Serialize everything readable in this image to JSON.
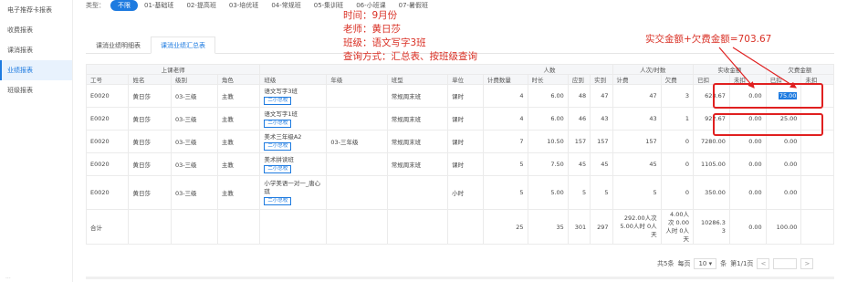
{
  "sidebar": {
    "items": [
      {
        "label": "电子推荐卡报表"
      },
      {
        "label": "收费报表"
      },
      {
        "label": "课消报表"
      },
      {
        "label": "业绩报表"
      },
      {
        "label": "班级报表"
      }
    ],
    "footer": "..."
  },
  "filters": {
    "label": "类型：",
    "chips": [
      "不限",
      "01-基础班",
      "02-提高班",
      "03-培优班",
      "04-常规班",
      "05-集训班",
      "06-小班课",
      "07-暑假班"
    ]
  },
  "tabs": [
    "课消业绩明细表",
    "课消业绩汇总表"
  ],
  "annotation_left": [
    "时间：9月份",
    "老师：黄日莎",
    "班级：语文写字3班",
    "查询方式：汇总表、按班级查询"
  ],
  "annotation_right": "实交金额+欠费金额=703.67",
  "table": {
    "group_headers": {
      "teacher": "上课老师",
      "persons": "人数",
      "person_times": "人次/时数",
      "receive": "实收金额",
      "owe": "欠费金额"
    },
    "columns": [
      "工号",
      "姓名",
      "级别",
      "角色",
      "班级",
      "年级",
      "班型",
      "单位",
      "计费数量",
      "时长",
      "应到",
      "实到",
      "计费",
      "欠费",
      "已扣",
      "未扣",
      "已扣",
      "未扣"
    ],
    "rows": [
      {
        "id": "E0020",
        "name": "黄日莎",
        "level": "03-三级",
        "role": "主教",
        "cls": "语文写字3班",
        "tag": "二小总校",
        "grade": "",
        "type": "常规周末班",
        "unit": "课时",
        "qty": "4",
        "dur": "6.00",
        "due": "48",
        "att": "47",
        "charge": "47",
        "owe": "3",
        "r1": "628.67",
        "r2": "0.00",
        "o1": "75.00",
        "o1_hl": true
      },
      {
        "id": "E0020",
        "name": "黄日莎",
        "level": "03-三级",
        "role": "主教",
        "cls": "语文写字1班",
        "tag": "二小总校",
        "grade": "",
        "type": "常规周末班",
        "unit": "课时",
        "qty": "4",
        "dur": "6.00",
        "due": "46",
        "att": "43",
        "charge": "43",
        "owe": "1",
        "r1": "922.67",
        "r2": "0.00",
        "o1": "25.00",
        "o1_hl": false
      },
      {
        "id": "E0020",
        "name": "黄日莎",
        "level": "03-三级",
        "role": "主教",
        "cls": "美术三年级A2",
        "tag": "二小总校",
        "grade": "03-三年级",
        "type": "常规周末班",
        "unit": "课时",
        "qty": "7",
        "dur": "10.50",
        "due": "157",
        "att": "157",
        "charge": "157",
        "owe": "0",
        "r1": "7280.00",
        "r2": "0.00",
        "o1": "0.00",
        "o1_hl": false
      },
      {
        "id": "E0020",
        "name": "黄日莎",
        "level": "03-三级",
        "role": "主教",
        "cls": "美术拼读班",
        "tag": "二小总校",
        "grade": "",
        "type": "常规周末班",
        "unit": "课时",
        "qty": "5",
        "dur": "7.50",
        "due": "45",
        "att": "45",
        "charge": "45",
        "owe": "0",
        "r1": "1105.00",
        "r2": "0.00",
        "o1": "0.00",
        "o1_hl": false
      },
      {
        "id": "E0020",
        "name": "黄日莎",
        "level": "03-三级",
        "role": "主教",
        "cls": "小学美语一对一_唐心琪",
        "tag": "二小总校",
        "grade": "",
        "type": "",
        "unit": "小时",
        "qty": "5",
        "dur": "5.00",
        "due": "5",
        "att": "5",
        "charge": "5",
        "owe": "0",
        "r1": "350.00",
        "r2": "0.00",
        "o1": "0.00",
        "o1_hl": false
      }
    ],
    "total": {
      "label": "合计",
      "qty": "25",
      "dur": "35",
      "due": "301",
      "att": "297",
      "charge": "292.00人次 5.00人时 0人天",
      "owe": "4.00人次 0.00人时 0人天",
      "r1": "10286.3 3",
      "r2": "0.00",
      "o1": "100.00"
    }
  },
  "pager": {
    "total": "共5条",
    "per_page_label": "每页",
    "per_page": "10",
    "per_page_unit": "条",
    "page": "第1/1页",
    "prev": "<",
    "next": ">"
  },
  "colors": {
    "accent": "#1e7be0",
    "annotation": "#e02020"
  }
}
